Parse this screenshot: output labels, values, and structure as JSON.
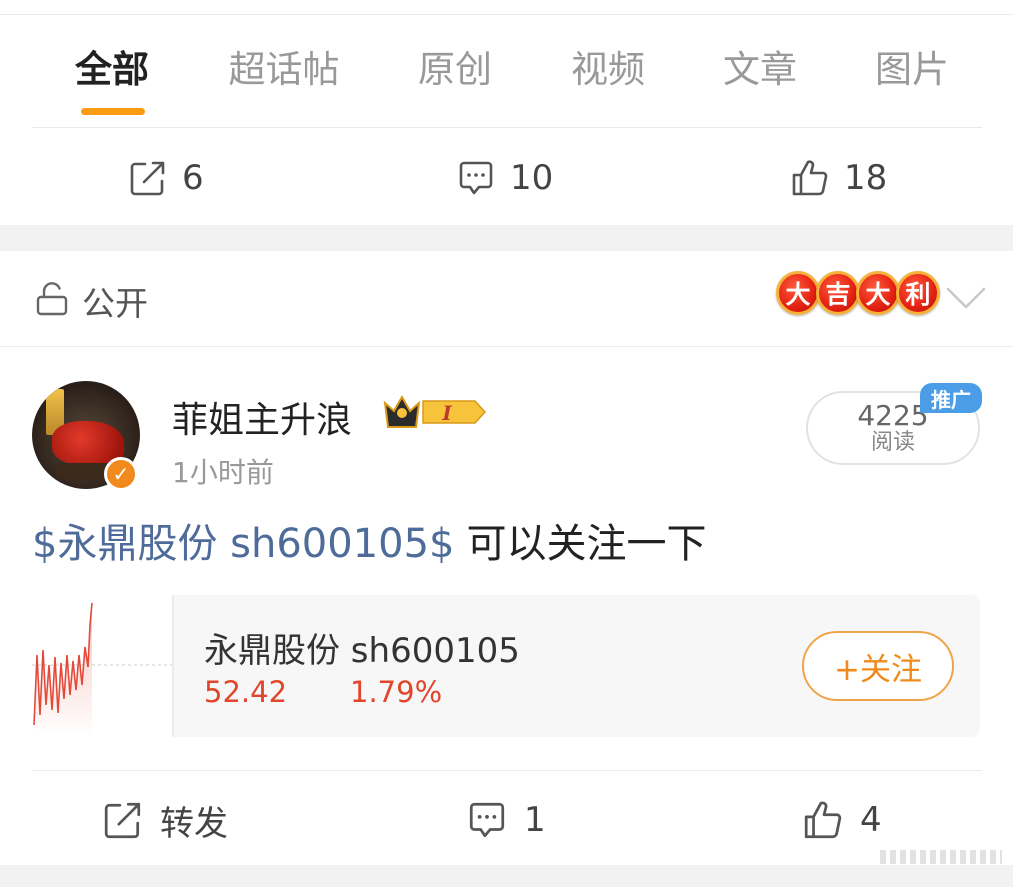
{
  "tabs": [
    {
      "label": "全部",
      "active": true
    },
    {
      "label": "超话帖",
      "active": false
    },
    {
      "label": "原创",
      "active": false
    },
    {
      "label": "视频",
      "active": false
    },
    {
      "label": "文章",
      "active": false
    },
    {
      "label": "图片",
      "active": false
    }
  ],
  "accent_color": "#fb9a13",
  "prev_post_actions": {
    "repost_count": "6",
    "comment_count": "10",
    "like_count": "18"
  },
  "post": {
    "visibility": "公开",
    "fortune_badge": [
      "大",
      "吉",
      "大",
      "利"
    ],
    "author": {
      "name": "菲姐主升浪",
      "verified": true,
      "vip_level": "I"
    },
    "time": "1小时前",
    "reads": {
      "count": "4225",
      "label": "阅读"
    },
    "promo_tag": "推广",
    "text": {
      "stock_tag": "$永鼎股份 sh600105$",
      "content": "可以关注一下"
    },
    "stock_card": {
      "name": "永鼎股份 sh600105",
      "price": "52.42",
      "change": "1.79%",
      "follow_label": "+关注",
      "change_color": "#e0462b"
    },
    "actions": {
      "repost_label": "转发",
      "comment_count": "1",
      "like_count": "4"
    }
  }
}
